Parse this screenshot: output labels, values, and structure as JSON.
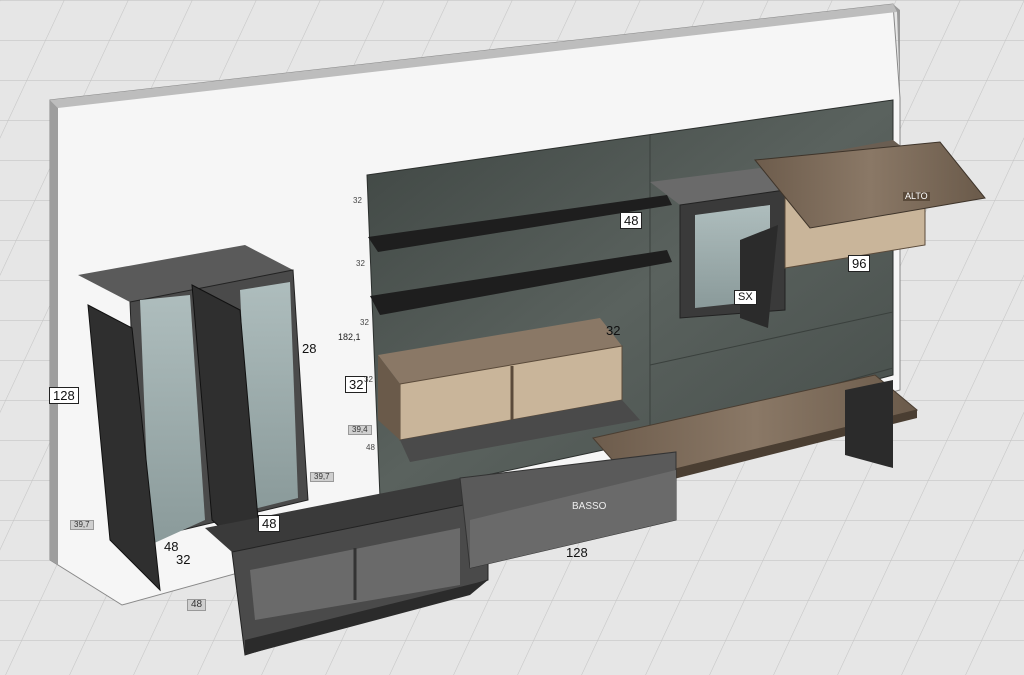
{
  "dimensions": {
    "shelf_top_width": "48",
    "wall_height": "128",
    "vitrine_depth": "28",
    "vitrine_base_width": "48",
    "vitrine_base_depth": "32",
    "base_unit_depth": "48",
    "base_unit_width": "48",
    "lower_cabinet_width": "128",
    "shelf_height_1": "32",
    "shelf_height_2": "32",
    "shelf_height_3": "32",
    "open_unit_height": "32",
    "panel_total_height": "182,1",
    "top_cabinet_width": "96",
    "bridge_width": "32",
    "side_depth": "39,7",
    "left_depth": "39,7",
    "misc_label_1": "39,4",
    "misc_label_2": "48",
    "misc_label_3": "32",
    "small_shelf_val": "32"
  },
  "tags": {
    "door_sx": "SX",
    "drawer_basso": "BASSO",
    "flap_alto": "ALTO"
  },
  "colors": {
    "floor": "#e4e4e4",
    "wall": "#f4f4f4",
    "panel": "#4a514e",
    "wood": "#7a6a58",
    "dark": "#2c2c2c",
    "anthracite": "#3c3c3c",
    "glass": "#9fb0b0"
  }
}
